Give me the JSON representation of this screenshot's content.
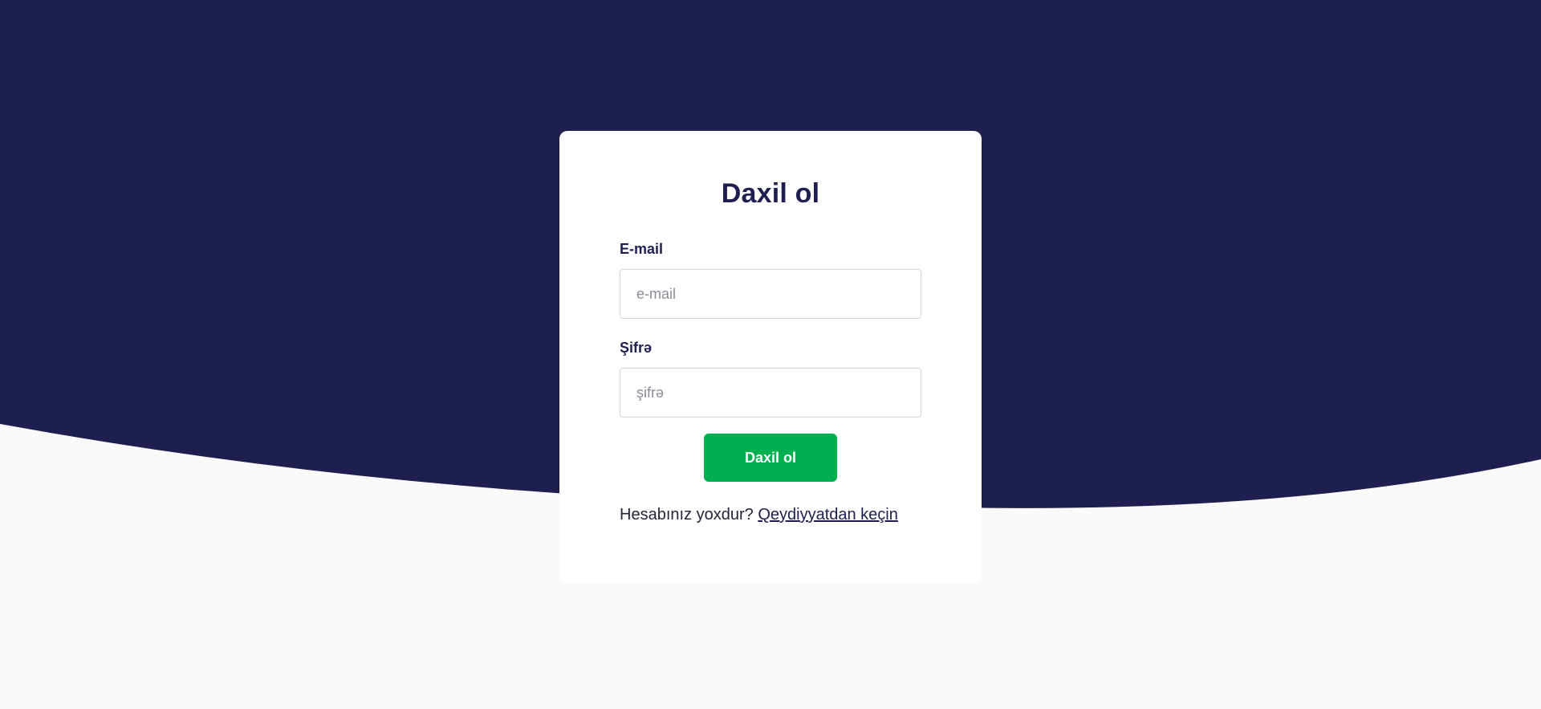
{
  "colors": {
    "header_background": "#1e1f50",
    "page_background": "#fafafb",
    "card_background": "#ffffff",
    "title_color": "#1e1f50",
    "button_background": "#00b050",
    "button_text": "#ffffff"
  },
  "login": {
    "title": "Daxil ol",
    "email": {
      "label": "E-mail",
      "placeholder": "e-mail",
      "value": ""
    },
    "password": {
      "label": "Şifrə",
      "placeholder": "şifrə",
      "value": ""
    },
    "submit_label": "Daxil ol",
    "no_account_text": "Hesabınız yoxdur?",
    "register_link_label": "Qeydiyyatdan keçin"
  }
}
